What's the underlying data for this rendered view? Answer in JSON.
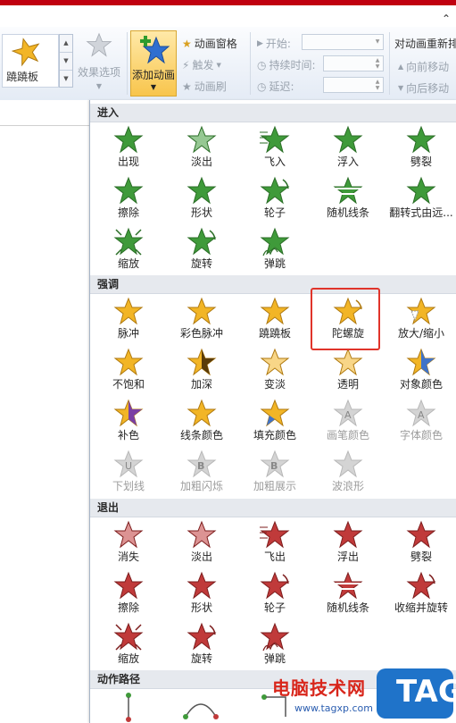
{
  "colors": {
    "green": "#3f9a3a",
    "gold": "#f2b526",
    "red": "#c03a3a",
    "gray": "#b8b8b8",
    "highlight": "#e0342a"
  },
  "ribbon": {
    "collapse_icon": "chevron-up-icon",
    "gallery_item_label": "蹺蹺板",
    "effect_options_label": "效果选项",
    "add_animation_label": "添加动画",
    "animation_pane_label": "动画窗格",
    "trigger_label": "触发",
    "animation_painter_label": "动画刷",
    "start_label": "开始:",
    "duration_label": "持续时间:",
    "delay_label": "延迟:",
    "reorder_title": "对动画重新排",
    "move_earlier_label": "向前移动",
    "move_later_label": "向后移动"
  },
  "sections": [
    {
      "title": "进入",
      "items": [
        {
          "label": "出现",
          "kind": "green",
          "disabled": false
        },
        {
          "label": "淡出",
          "kind": "green-fade",
          "disabled": false
        },
        {
          "label": "飞入",
          "kind": "green-fly",
          "disabled": false
        },
        {
          "label": "浮入",
          "kind": "green-float",
          "disabled": false
        },
        {
          "label": "劈裂",
          "kind": "green-split",
          "disabled": false
        },
        {
          "label": "擦除",
          "kind": "green-wipe",
          "disabled": false
        },
        {
          "label": "形状",
          "kind": "green-shape",
          "disabled": false
        },
        {
          "label": "轮子",
          "kind": "green-wheel",
          "disabled": false
        },
        {
          "label": "随机线条",
          "kind": "green-lines",
          "disabled": false
        },
        {
          "label": "翻转式由远...",
          "kind": "green-flip",
          "disabled": false
        },
        {
          "label": "缩放",
          "kind": "green-zoom",
          "disabled": false
        },
        {
          "label": "旋转",
          "kind": "green-spin",
          "disabled": false
        },
        {
          "label": "弹跳",
          "kind": "green-bounce",
          "disabled": false
        }
      ]
    },
    {
      "title": "强调",
      "items": [
        {
          "label": "脉冲",
          "kind": "gold",
          "disabled": false
        },
        {
          "label": "彩色脉冲",
          "kind": "gold-glow",
          "disabled": false
        },
        {
          "label": "蹺蹺板",
          "kind": "gold-teeter",
          "disabled": false
        },
        {
          "label": "陀螺旋",
          "kind": "gold-spin",
          "disabled": false
        },
        {
          "label": "放大/缩小",
          "kind": "gold-grow",
          "disabled": false
        },
        {
          "label": "不饱和",
          "kind": "gold-desat",
          "disabled": false
        },
        {
          "label": "加深",
          "kind": "gold-dark",
          "disabled": false
        },
        {
          "label": "变淡",
          "kind": "gold-light",
          "disabled": false
        },
        {
          "label": "透明",
          "kind": "gold-trans",
          "disabled": false
        },
        {
          "label": "对象颜色",
          "kind": "gold-blue",
          "disabled": false
        },
        {
          "label": "补色",
          "kind": "gold-purple",
          "disabled": false
        },
        {
          "label": "线条颜色",
          "kind": "gold-line",
          "disabled": false
        },
        {
          "label": "填充颜色",
          "kind": "gold-fill",
          "disabled": false
        },
        {
          "label": "画笔颜色",
          "kind": "gray-a",
          "disabled": true
        },
        {
          "label": "字体颜色",
          "kind": "gray-a",
          "disabled": true
        },
        {
          "label": "下划线",
          "kind": "gray-u",
          "disabled": true
        },
        {
          "label": "加粗闪烁",
          "kind": "gray-b",
          "disabled": true
        },
        {
          "label": "加粗展示",
          "kind": "gray-b",
          "disabled": true
        },
        {
          "label": "波浪形",
          "kind": "gray",
          "disabled": true
        }
      ]
    },
    {
      "title": "退出",
      "items": [
        {
          "label": "消失",
          "kind": "red-vanish",
          "disabled": false
        },
        {
          "label": "淡出",
          "kind": "red-fade",
          "disabled": false
        },
        {
          "label": "飞出",
          "kind": "red-fly",
          "disabled": false
        },
        {
          "label": "浮出",
          "kind": "red-float",
          "disabled": false
        },
        {
          "label": "劈裂",
          "kind": "red-split",
          "disabled": false
        },
        {
          "label": "擦除",
          "kind": "red",
          "disabled": false
        },
        {
          "label": "形状",
          "kind": "red-shape",
          "disabled": false
        },
        {
          "label": "轮子",
          "kind": "red-wheel",
          "disabled": false
        },
        {
          "label": "随机线条",
          "kind": "red-lines",
          "disabled": false
        },
        {
          "label": "收缩并旋转",
          "kind": "red-shrink",
          "disabled": false
        },
        {
          "label": "缩放",
          "kind": "red-zoom",
          "disabled": false
        },
        {
          "label": "旋转",
          "kind": "red-spin",
          "disabled": false
        },
        {
          "label": "弹跳",
          "kind": "red-bounce",
          "disabled": false
        }
      ]
    },
    {
      "title": "动作路径",
      "items": []
    }
  ],
  "watermark": {
    "text": "电脑技术网",
    "url": "www.tagxp.com",
    "badge": "TAG"
  }
}
